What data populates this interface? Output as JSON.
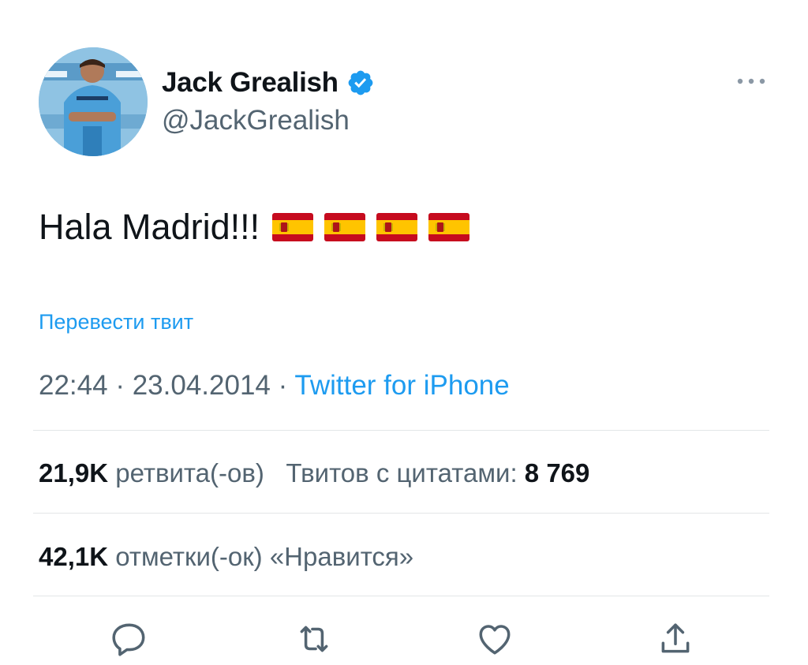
{
  "tweet": {
    "author": {
      "display_name": "Jack Grealish",
      "handle": "@JackGrealish",
      "verified": true
    },
    "text": "Hala Madrid!!!",
    "emoji_flags": [
      "flag-spain",
      "flag-spain",
      "flag-spain",
      "flag-spain"
    ],
    "translate_label": "Перевести твит",
    "time": "22:44",
    "separator": "·",
    "date": "23.04.2014",
    "source": "Twitter for iPhone",
    "stats": {
      "retweets_count": "21,9K",
      "retweets_label": "ретвита(-ов)",
      "quotes_label": "Твитов с цитатами:",
      "quotes_count": "8 769",
      "likes_count": "42,1K",
      "likes_label": "отметки(-ок) «Нравится»"
    },
    "actions": [
      "reply-icon",
      "retweet-icon",
      "like-icon",
      "share-icon"
    ]
  },
  "colors": {
    "link": "#1d9bf0",
    "secondary_text": "#536471",
    "primary_text": "#0f1419",
    "divider": "#e3e6e8"
  }
}
